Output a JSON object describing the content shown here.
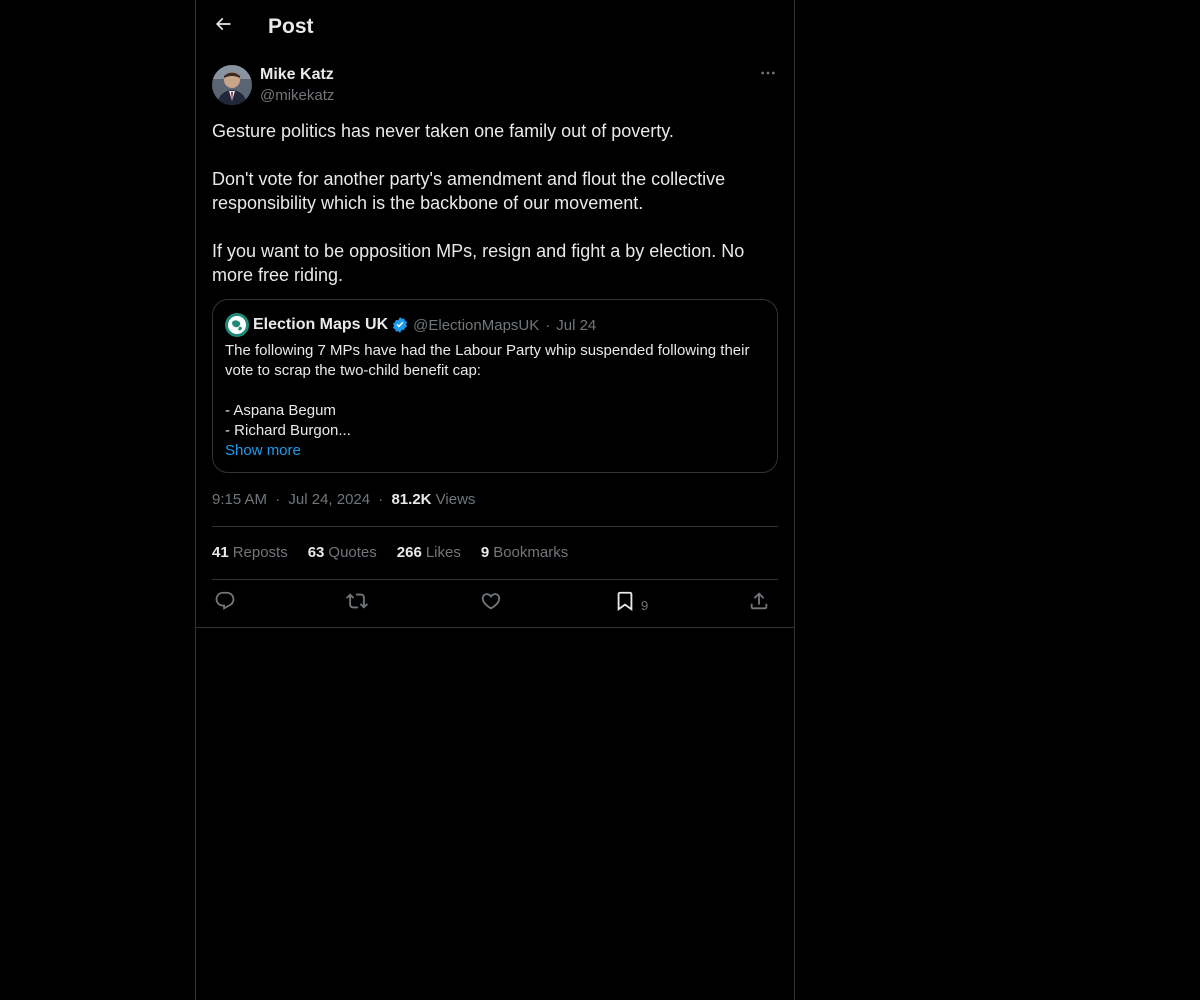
{
  "header": {
    "title": "Post"
  },
  "author": {
    "name": "Mike Katz",
    "handle": "@mikekatz"
  },
  "post": {
    "text": "Gesture politics has never taken one family out of poverty.\n\nDon't vote for another party's amendment and flout the collective responsibility which is the backbone of our movement.\n\nIf you want to be opposition MPs, resign and fight a by election. No more free riding."
  },
  "quote": {
    "name": "Election Maps UK",
    "handle": "@ElectionMapsUK",
    "separator": "·",
    "date": "Jul 24",
    "text": "The following 7 MPs have had the Labour Party whip suspended following their vote to scrap the two-child benefit cap:\n\n- Aspana Begum\n- Richard Burgon...",
    "show_more": "Show more"
  },
  "meta": {
    "time": "9:15 AM",
    "separator": "·",
    "date": "Jul 24, 2024",
    "views_count": "81.2K",
    "views_label": "Views"
  },
  "stats": {
    "reposts_count": "41",
    "reposts_label": "Reposts",
    "quotes_count": "63",
    "quotes_label": "Quotes",
    "likes_count": "266",
    "likes_label": "Likes",
    "bookmarks_count": "9",
    "bookmarks_label": "Bookmarks"
  },
  "actions": {
    "bookmark_count": "9"
  },
  "icons": {
    "back": "arrow-left-icon",
    "more": "more-horizontal-icon",
    "verified": "verified-badge-icon",
    "reply": "reply-icon",
    "repost": "repost-icon",
    "like": "heart-icon",
    "bookmark": "bookmark-icon",
    "share": "share-icon"
  },
  "colors": {
    "background": "#000000",
    "text": "#e7e9ea",
    "secondary_text": "#71767b",
    "border": "#2f3336",
    "accent": "#1d9bf0"
  }
}
